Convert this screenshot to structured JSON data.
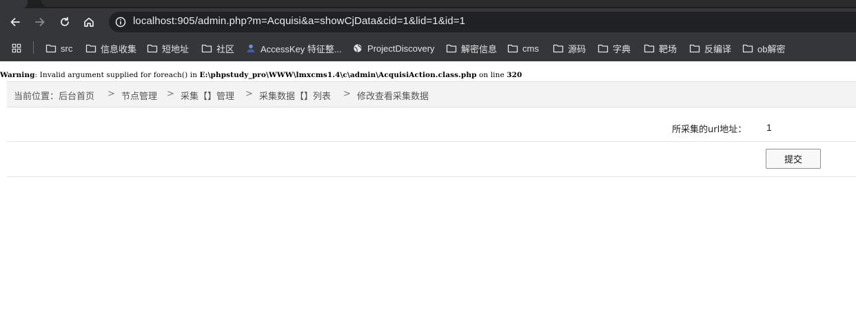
{
  "browser": {
    "url": "localhost:905/admin.php?m=Acquisi&a=showCjData&cid=1&lid=1&id=1",
    "bookmarks": [
      {
        "label": "src",
        "icon": "folder-icon"
      },
      {
        "label": "信息收集",
        "icon": "folder-icon"
      },
      {
        "label": "短地址",
        "icon": "folder-icon"
      },
      {
        "label": "社区",
        "icon": "folder-icon"
      },
      {
        "label": "AccessKey 特征整...",
        "icon": "avatar-icon"
      },
      {
        "label": "ProjectDiscovery",
        "icon": "globe-icon"
      },
      {
        "label": "解密信息",
        "icon": "folder-icon"
      },
      {
        "label": "cms",
        "icon": "folder-icon"
      },
      {
        "label": "源码",
        "icon": "folder-icon"
      },
      {
        "label": "字典",
        "icon": "folder-icon"
      },
      {
        "label": "靶场",
        "icon": "folder-icon"
      },
      {
        "label": "反编译",
        "icon": "folder-icon"
      },
      {
        "label": "ob解密",
        "icon": "folder-icon"
      }
    ]
  },
  "warning": {
    "prefix": "Warning",
    "message": ": Invalid argument supplied for foreach() in ",
    "path": "E:\\phpstudy_pro\\WWW\\lmxcms1.4\\c\\admin\\AcquisiAction.class.php",
    "line_text": " on line ",
    "line": "320"
  },
  "breadcrumb": {
    "items": [
      "当前位置：后台首页",
      "节点管理",
      "采集【】管理",
      "采集数据【】列表",
      "修改查看采集数据"
    ],
    "separator": ">"
  },
  "form": {
    "url_label": "所采集的url地址：",
    "url_value": "1",
    "submit_label": "提交"
  },
  "colors": {
    "chrome_bg": "#35363a",
    "omnibox_bg": "#202124",
    "breadcrumb_bg": "#f3f3f3"
  }
}
